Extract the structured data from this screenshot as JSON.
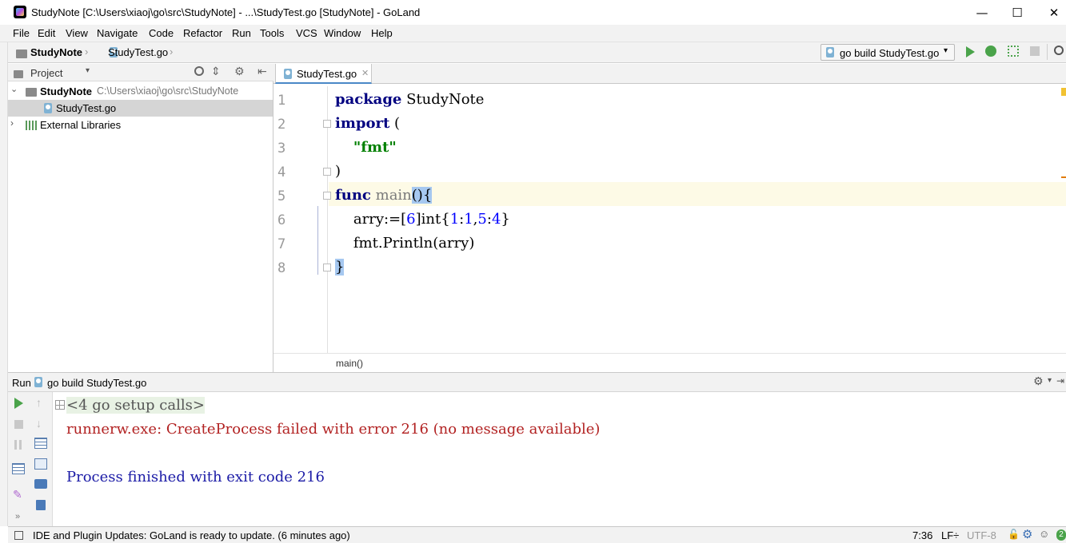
{
  "window": {
    "title": "StudyNote [C:\\Users\\xiaoj\\go\\src\\StudyNote] - ...\\StudyTest.go [StudyNote] - GoLand",
    "minimize": "—",
    "maximize": "☐",
    "close": "✕"
  },
  "menu": [
    "File",
    "Edit",
    "View",
    "Navigate",
    "Code",
    "Refactor",
    "Run",
    "Tools",
    "VCS",
    "Window",
    "Help"
  ],
  "navbar": {
    "project": "StudyNote",
    "file": "StudyTest.go",
    "run_config": "go build StudyTest.go"
  },
  "project_panel": {
    "header": "Project",
    "root_name": "StudyNote",
    "root_path": "C:\\Users\\xiaoj\\go\\src\\StudyNote",
    "file": "StudyTest.go",
    "external": "External Libraries"
  },
  "editor": {
    "tab_label": "StudyTest.go",
    "line_numbers": [
      "1",
      "2",
      "3",
      "4",
      "5",
      "6",
      "7",
      "8"
    ],
    "breadcrumb": "main()"
  },
  "run_panel": {
    "label": "Run",
    "config": "go build StudyTest.go",
    "setup_calls": "<4 go setup calls>",
    "error": "runnerw.exe: CreateProcess failed with error 216 (no message available)",
    "finished": "Process finished with exit code 216"
  },
  "status_bar": {
    "message": "IDE and Plugin Updates: GoLand is ready to update. (6 minutes ago)",
    "position": "7:36",
    "line_sep": "LF÷",
    "encoding": "UTF-8",
    "badge": "2"
  },
  "colors": {
    "accent_blue": "#4a88c7",
    "keyword": "#000080",
    "string": "#008000",
    "number": "#0000ff",
    "error_text": "#b22222",
    "console_info": "#1a1aa6",
    "run_green": "#4aa34a"
  }
}
